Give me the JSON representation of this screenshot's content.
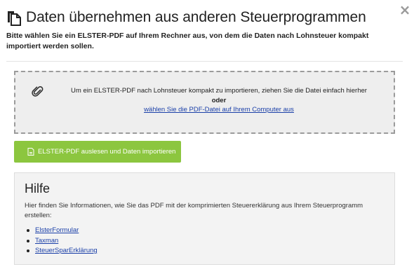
{
  "dialog": {
    "title": "Daten übernehmen aus anderen Steuerprogrammen",
    "close_symbol": "×",
    "subtitle": "Bitte wählen Sie ein ELSTER-PDF auf Ihrem Rechner aus, von dem die Daten nach Lohnsteuer kompakt importiert werden sollen."
  },
  "dropzone": {
    "icon": "paperclip-icon",
    "instruction": "Um ein ELSTER-PDF nach Lohnsteuer kompakt zu importieren, ziehen Sie die Datei einfach hierher",
    "or_label": "oder",
    "select_link": "wählen Sie die PDF-Datei auf Ihrem Computer aus"
  },
  "import_button": {
    "icon": "pdf-file-icon",
    "label": "ELSTER-PDF auslesen und Daten importieren",
    "color": "#8cc63f"
  },
  "help": {
    "title": "Hilfe",
    "text": "Hier finden Sie Informationen, wie Sie das PDF mit der komprimierten Steuererklärung aus Ihrem Steuerprogramm erstellen:",
    "links": [
      "ElsterFormular",
      "Taxman",
      "SteuerSparErklärung"
    ]
  },
  "colors": {
    "link": "#1a3fa8",
    "dropzone_bg": "#eeeeee",
    "help_bg": "#f3f3f3"
  }
}
